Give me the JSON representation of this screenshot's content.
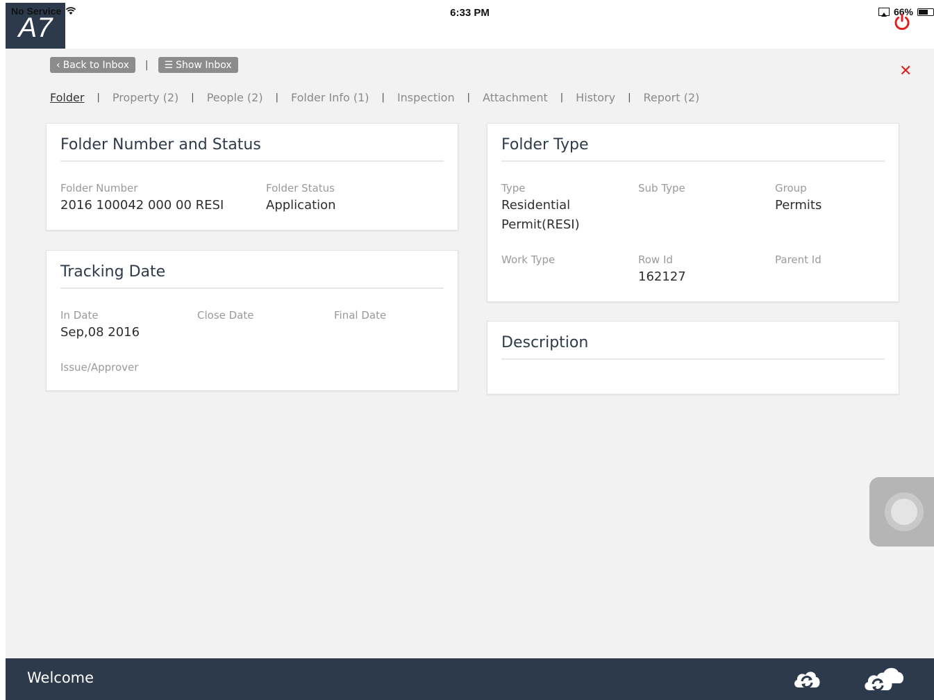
{
  "status_bar": {
    "carrier": "No Service",
    "time": "6:33 PM",
    "battery": "66%",
    "battery_level": 0.66
  },
  "app": {
    "logo": "A7"
  },
  "toolbar": {
    "back_label": "Back to Inbox",
    "show_inbox_label": "Show Inbox",
    "separator": "|"
  },
  "tabs": [
    {
      "label": "Folder",
      "active": true
    },
    {
      "label": "Property (2)"
    },
    {
      "label": "People (2)"
    },
    {
      "label": "Folder Info (1)"
    },
    {
      "label": "Inspection"
    },
    {
      "label": "Attachment"
    },
    {
      "label": "History"
    },
    {
      "label": "Report (2)"
    }
  ],
  "folder_number_status": {
    "title": "Folder Number and Status",
    "folder_number_label": "Folder Number",
    "folder_number_value": "2016 100042 000 00 RESI",
    "folder_status_label": "Folder Status",
    "folder_status_value": "Application"
  },
  "tracking_date": {
    "title": "Tracking Date",
    "in_date_label": "In Date",
    "in_date_value": "Sep,08 2016",
    "close_date_label": "Close Date",
    "final_date_label": "Final Date",
    "issue_label": "Issue/Approver"
  },
  "folder_type": {
    "title": "Folder Type",
    "type_label": "Type",
    "type_value_line1": "Residential",
    "type_value_line2": "Permit(RESI)",
    "sub_type_label": "Sub Type",
    "group_label": "Group",
    "group_value": "Permits",
    "work_type_label": "Work Type",
    "row_id_label": "Row Id",
    "row_id_value": "162127",
    "parent_id_label": "Parent Id"
  },
  "description": {
    "title": "Description"
  },
  "footer": {
    "welcome": "Welcome"
  },
  "colors": {
    "navy": "#2c3a4c",
    "close_red": "#e02020",
    "button_gray": "#8c8c8c",
    "background": "#f2f2f2"
  }
}
